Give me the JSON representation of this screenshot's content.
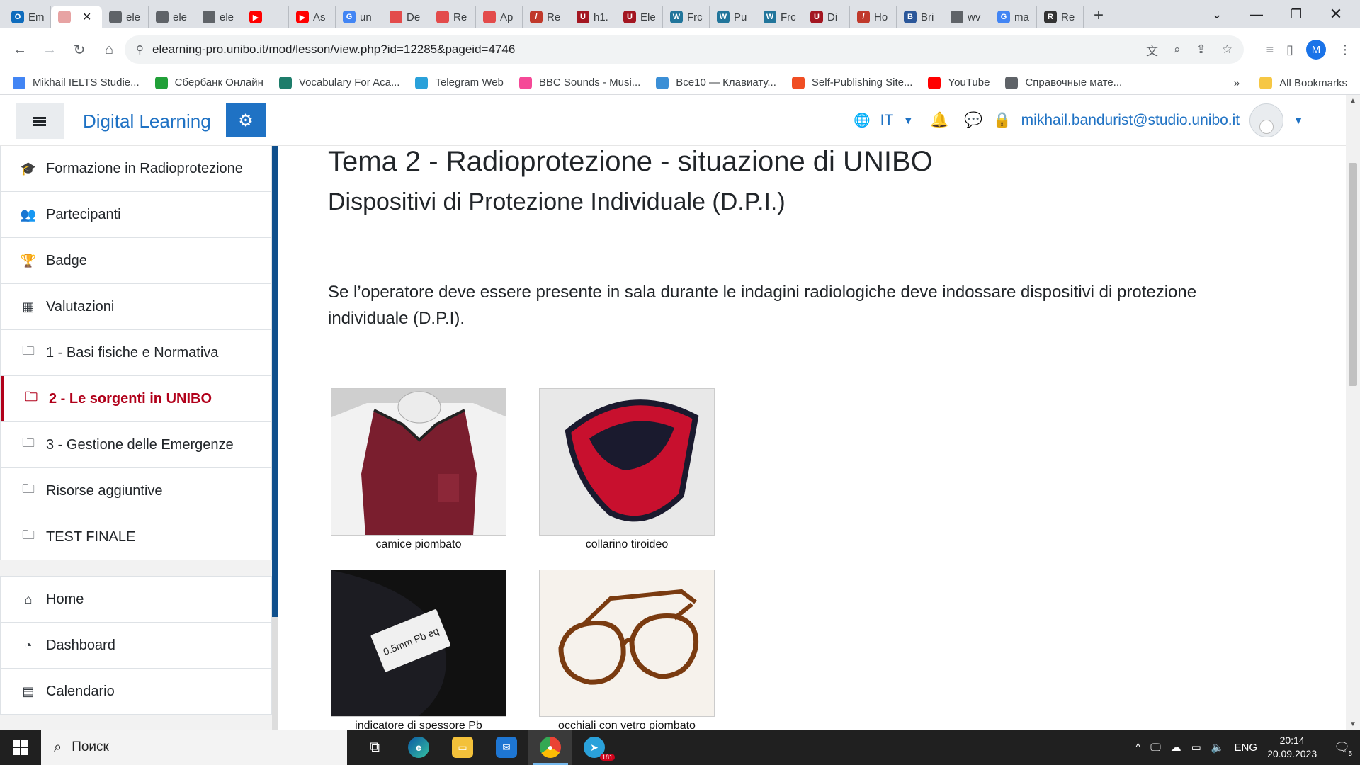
{
  "browser": {
    "tabs": [
      {
        "label": "Em",
        "color": "#0f6cbd",
        "glyph": "O"
      },
      {
        "label": "",
        "color": "#e7a3a3",
        "glyph": "",
        "active": true
      },
      {
        "label": "ele",
        "color": "#5f6368",
        "glyph": ""
      },
      {
        "label": "ele",
        "color": "#5f6368",
        "glyph": ""
      },
      {
        "label": "ele",
        "color": "#5f6368",
        "glyph": ""
      },
      {
        "label": "",
        "color": "#ff0000",
        "glyph": "▶"
      },
      {
        "label": "As",
        "color": "#ff0000",
        "glyph": "▶"
      },
      {
        "label": "un",
        "color": "#4285f4",
        "glyph": "G"
      },
      {
        "label": "De",
        "color": "#e34b4b",
        "glyph": ""
      },
      {
        "label": "Re",
        "color": "#e34b4b",
        "glyph": ""
      },
      {
        "label": "Ap",
        "color": "#e34b4b",
        "glyph": ""
      },
      {
        "label": "Re",
        "color": "#c0392b",
        "glyph": "/"
      },
      {
        "label": "h1.",
        "color": "#a31621",
        "glyph": "U"
      },
      {
        "label": "Ele",
        "color": "#a31621",
        "glyph": "U"
      },
      {
        "label": "Frc",
        "color": "#21759b",
        "glyph": "W"
      },
      {
        "label": "Pu",
        "color": "#21759b",
        "glyph": "W"
      },
      {
        "label": "Frc",
        "color": "#21759b",
        "glyph": "W"
      },
      {
        "label": "Di",
        "color": "#a31621",
        "glyph": "U"
      },
      {
        "label": "Ho",
        "color": "#c0392b",
        "glyph": "/"
      },
      {
        "label": "Bri",
        "color": "#2b579a",
        "glyph": "B"
      },
      {
        "label": "wv",
        "color": "#5f6368",
        "glyph": ""
      },
      {
        "label": "ma",
        "color": "#4285f4",
        "glyph": "G"
      },
      {
        "label": "Re",
        "color": "#333333",
        "glyph": "R"
      }
    ],
    "url": "elearning-pro.unibo.it/mod/lesson/view.php?id=12285&pageid=4746",
    "profile_initial": "M",
    "bookmarks": [
      {
        "label": "Mikhail IELTS Studie...",
        "color": "#4285f4"
      },
      {
        "label": "Сбербанк Онлайн",
        "color": "#21a038"
      },
      {
        "label": "Vocabulary For Aca...",
        "color": "#1e7d6b"
      },
      {
        "label": "Telegram Web",
        "color": "#2aa1da"
      },
      {
        "label": "BBC Sounds - Musi...",
        "color": "#f54997"
      },
      {
        "label": "Все10 — Клавиату...",
        "color": "#3b8fd6"
      },
      {
        "label": "Self-Publishing Site...",
        "color": "#f04e23"
      },
      {
        "label": "YouTube",
        "color": "#ff0000"
      },
      {
        "label": "Справочные мате...",
        "color": "#5f6368"
      }
    ],
    "bookmarks_overflow": "»",
    "all_bookmarks": "All Bookmarks"
  },
  "moodle": {
    "brand": "Digital Learning",
    "lang": "IT",
    "user_email": "mikhail.bandurist@studio.unibo.it",
    "drawer": {
      "course_items": [
        {
          "label": "Formazione in Radioprotezione",
          "icon": "graduation-cap-icon",
          "glyph": "🎓"
        },
        {
          "label": "Partecipanti",
          "icon": "users-icon",
          "glyph": "👥"
        },
        {
          "label": "Badge",
          "icon": "trophy-icon",
          "glyph": "🏆"
        },
        {
          "label": "Valutazioni",
          "icon": "table-icon",
          "glyph": "▦"
        },
        {
          "label": "1 - Basi fisiche e Normativa",
          "icon": "folder-icon",
          "glyph": "🗀"
        },
        {
          "label": "2 - Le sorgenti in UNIBO",
          "icon": "folder-icon",
          "glyph": "🗀",
          "active": true
        },
        {
          "label": "3 - Gestione delle Emergenze",
          "icon": "folder-icon",
          "glyph": "🗀"
        },
        {
          "label": "Risorse aggiuntive",
          "icon": "folder-icon",
          "glyph": "🗀"
        },
        {
          "label": "TEST FINALE",
          "icon": "folder-icon",
          "glyph": "🗀"
        }
      ],
      "site_items": [
        {
          "label": "Home",
          "icon": "home-icon",
          "glyph": "⌂"
        },
        {
          "label": "Dashboard",
          "icon": "dashboard-icon",
          "glyph": "◔"
        },
        {
          "label": "Calendario",
          "icon": "calendar-icon",
          "glyph": "▤"
        }
      ]
    },
    "content": {
      "title": "Tema 2 - Radioprotezione - situazione di UNIBO",
      "subtitle": "Dispositivi di Protezione Individuale (D.P.I.)",
      "paragraph": "Se l’operatore deve essere presente in sala durante le indagini radiologiche deve indossare dispositivi di protezione individuale (D.P.I).",
      "figures": [
        {
          "caption": "camice piombato"
        },
        {
          "caption": "collarino tiroideo"
        },
        {
          "caption": "indicatore di spessore Pb",
          "label": "0.5mm Pb eq"
        },
        {
          "caption": "occhiali con vetro piombato"
        }
      ]
    }
  },
  "taskbar": {
    "search_placeholder": "Поиск",
    "lang": "ENG",
    "time": "20:14",
    "date": "20.09.2023",
    "telegram_badge": "181",
    "notifications": "5"
  }
}
